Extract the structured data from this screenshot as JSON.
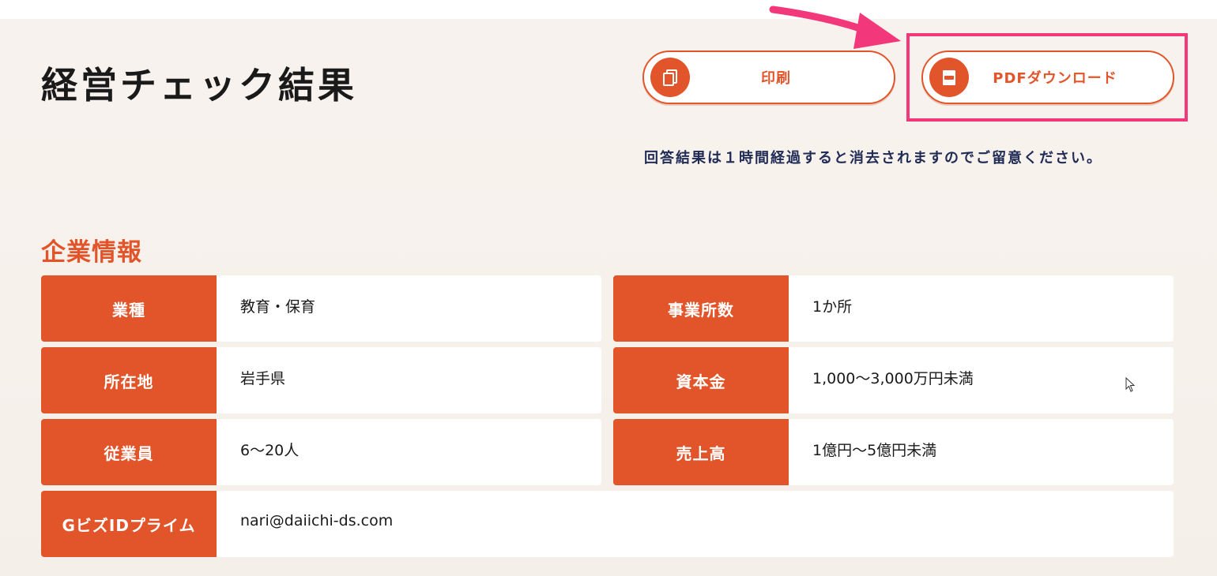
{
  "header": {
    "title": "経営チェック結果"
  },
  "actions": {
    "print_label": "印刷",
    "pdf_label": "PDFダウンロード"
  },
  "notice": "回答結果は１時間経過すると消去されますのでご留意ください。",
  "company_info": {
    "section_title": "企業情報",
    "rows": [
      {
        "label": "業種",
        "value": "教育・保育"
      },
      {
        "label": "事業所数",
        "value": "1か所"
      },
      {
        "label": "所在地",
        "value": "岩手県"
      },
      {
        "label": "資本金",
        "value": "1,000〜3,000万円未満"
      },
      {
        "label": "従業員",
        "value": "6〜20人"
      },
      {
        "label": "売上高",
        "value": "1億円〜5億円未満"
      },
      {
        "label": "GビズIDプライム",
        "value": "nari@daiichi-ds.com"
      }
    ]
  },
  "colors": {
    "accent": "#e2552a",
    "highlight": "#f2387a",
    "notice_text": "#1f2a55"
  },
  "icons": [
    "document-copy-icon",
    "pdf-file-icon",
    "annotation-arrow-icon",
    "mouse-cursor-icon"
  ]
}
